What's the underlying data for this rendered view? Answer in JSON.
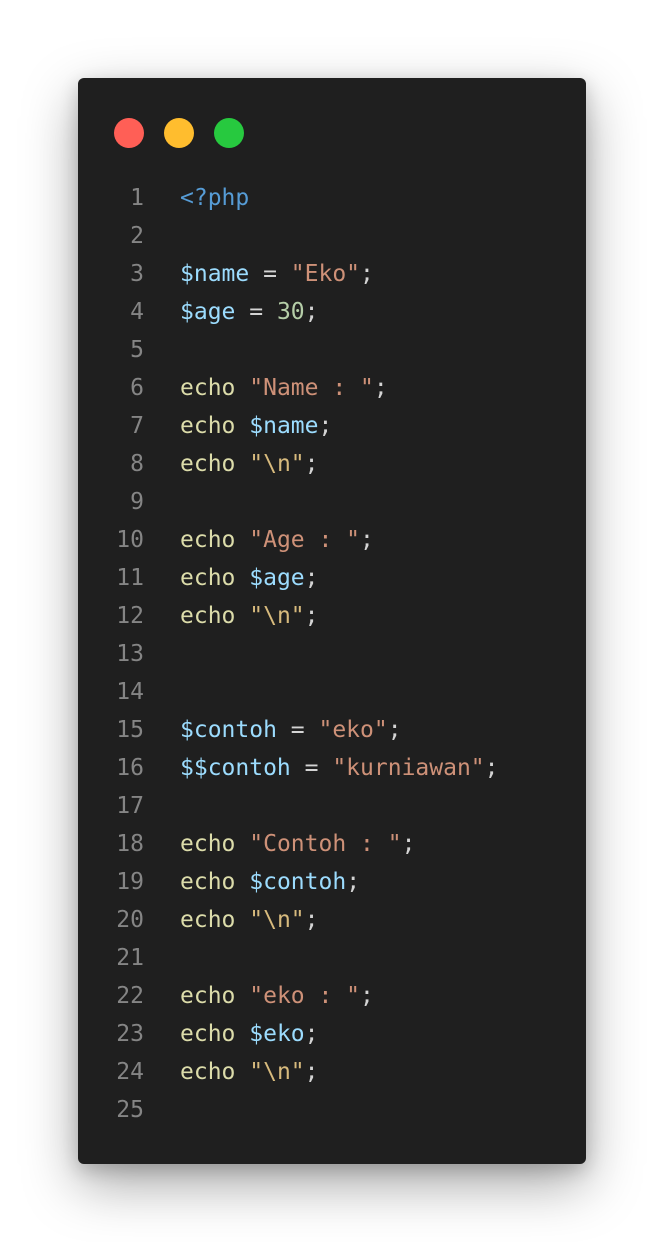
{
  "window": {
    "colors": {
      "background": "#1f1f1f",
      "close_dot": "#ff5f56",
      "minimize_dot": "#ffbd2e",
      "maximize_dot": "#27c93f"
    }
  },
  "code": {
    "language": "php",
    "lines": [
      {
        "num": "1",
        "tokens": [
          [
            "tag",
            "<?php"
          ]
        ]
      },
      {
        "num": "2",
        "tokens": []
      },
      {
        "num": "3",
        "tokens": [
          [
            "var",
            "$name"
          ],
          [
            "op",
            " = "
          ],
          [
            "str",
            "\"Eko\""
          ],
          [
            "op",
            ";"
          ]
        ]
      },
      {
        "num": "4",
        "tokens": [
          [
            "var",
            "$age"
          ],
          [
            "op",
            " = "
          ],
          [
            "num",
            "30"
          ],
          [
            "op",
            ";"
          ]
        ]
      },
      {
        "num": "5",
        "tokens": []
      },
      {
        "num": "6",
        "tokens": [
          [
            "kw",
            "echo"
          ],
          [
            "op",
            " "
          ],
          [
            "str",
            "\"Name : \""
          ],
          [
            "op",
            ";"
          ]
        ]
      },
      {
        "num": "7",
        "tokens": [
          [
            "kw",
            "echo"
          ],
          [
            "op",
            " "
          ],
          [
            "var",
            "$name"
          ],
          [
            "op",
            ";"
          ]
        ]
      },
      {
        "num": "8",
        "tokens": [
          [
            "kw",
            "echo"
          ],
          [
            "op",
            " "
          ],
          [
            "esc",
            "\"\\n\""
          ],
          [
            "op",
            ";"
          ]
        ]
      },
      {
        "num": "9",
        "tokens": []
      },
      {
        "num": "10",
        "tokens": [
          [
            "kw",
            "echo"
          ],
          [
            "op",
            " "
          ],
          [
            "str",
            "\"Age : \""
          ],
          [
            "op",
            ";"
          ]
        ]
      },
      {
        "num": "11",
        "tokens": [
          [
            "kw",
            "echo"
          ],
          [
            "op",
            " "
          ],
          [
            "var",
            "$age"
          ],
          [
            "op",
            ";"
          ]
        ]
      },
      {
        "num": "12",
        "tokens": [
          [
            "kw",
            "echo"
          ],
          [
            "op",
            " "
          ],
          [
            "esc",
            "\"\\n\""
          ],
          [
            "op",
            ";"
          ]
        ]
      },
      {
        "num": "13",
        "tokens": []
      },
      {
        "num": "14",
        "tokens": []
      },
      {
        "num": "15",
        "tokens": [
          [
            "var",
            "$contoh"
          ],
          [
            "op",
            " = "
          ],
          [
            "str",
            "\"eko\""
          ],
          [
            "op",
            ";"
          ]
        ]
      },
      {
        "num": "16",
        "tokens": [
          [
            "var",
            "$$contoh"
          ],
          [
            "op",
            " = "
          ],
          [
            "str",
            "\"kurniawan\""
          ],
          [
            "op",
            ";"
          ]
        ]
      },
      {
        "num": "17",
        "tokens": []
      },
      {
        "num": "18",
        "tokens": [
          [
            "kw",
            "echo"
          ],
          [
            "op",
            " "
          ],
          [
            "str",
            "\"Contoh : \""
          ],
          [
            "op",
            ";"
          ]
        ]
      },
      {
        "num": "19",
        "tokens": [
          [
            "kw",
            "echo"
          ],
          [
            "op",
            " "
          ],
          [
            "var",
            "$contoh"
          ],
          [
            "op",
            ";"
          ]
        ]
      },
      {
        "num": "20",
        "tokens": [
          [
            "kw",
            "echo"
          ],
          [
            "op",
            " "
          ],
          [
            "esc",
            "\"\\n\""
          ],
          [
            "op",
            ";"
          ]
        ]
      },
      {
        "num": "21",
        "tokens": []
      },
      {
        "num": "22",
        "tokens": [
          [
            "kw",
            "echo"
          ],
          [
            "op",
            " "
          ],
          [
            "str",
            "\"eko : \""
          ],
          [
            "op",
            ";"
          ]
        ]
      },
      {
        "num": "23",
        "tokens": [
          [
            "kw",
            "echo"
          ],
          [
            "op",
            " "
          ],
          [
            "var",
            "$eko"
          ],
          [
            "op",
            ";"
          ]
        ]
      },
      {
        "num": "24",
        "tokens": [
          [
            "kw",
            "echo"
          ],
          [
            "op",
            " "
          ],
          [
            "esc",
            "\"\\n\""
          ],
          [
            "op",
            ";"
          ]
        ]
      },
      {
        "num": "25",
        "tokens": []
      }
    ]
  }
}
